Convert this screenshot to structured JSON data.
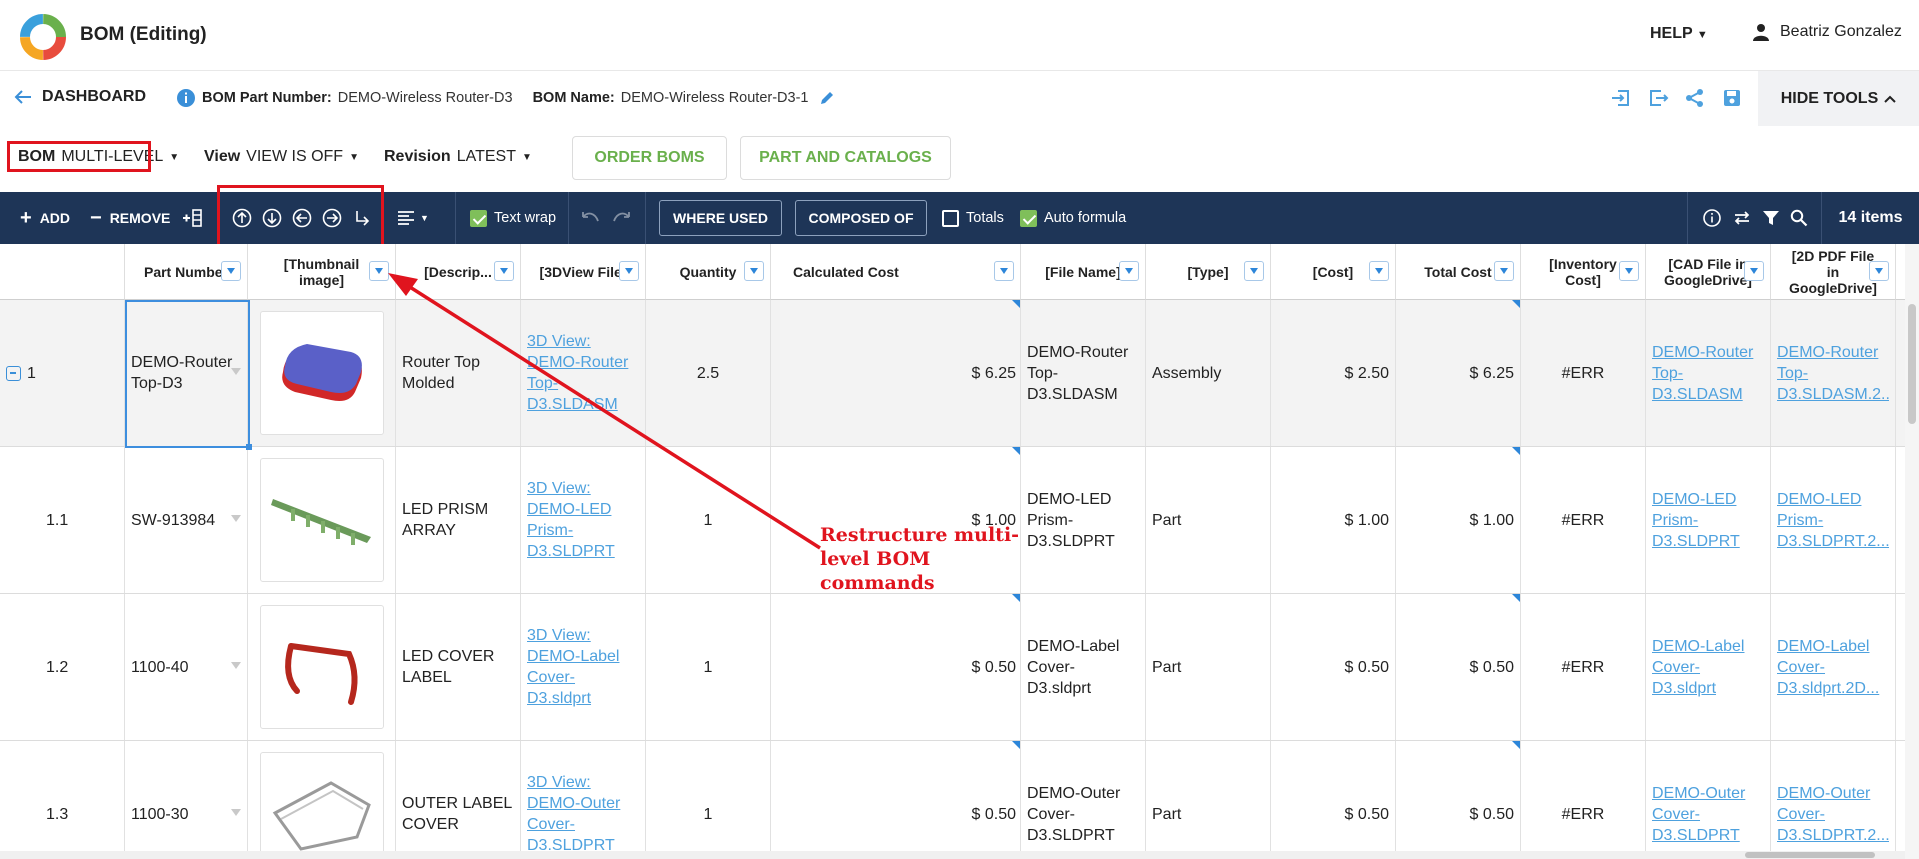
{
  "app": {
    "title": "BOM (Editing)",
    "help_label": "HELP",
    "user_name": "Beatriz Gonzalez"
  },
  "info": {
    "dashboard_label": "DASHBOARD",
    "part_number_label": "BOM Part Number:",
    "part_number_value": "DEMO-Wireless Router-D3",
    "bom_name_label": "BOM Name:",
    "bom_name_value": "DEMO-Wireless Router-D3-1",
    "hide_tools_label": "HIDE TOOLS"
  },
  "controls": {
    "bom_label": "BOM",
    "bom_value": "MULTI-LEVEL",
    "view_label": "View",
    "view_value": "VIEW IS OFF",
    "revision_label": "Revision",
    "revision_value": "LATEST",
    "order_boms": "ORDER BOMS",
    "part_catalogs": "PART AND CATALOGS"
  },
  "toolbar": {
    "add": "ADD",
    "remove": "REMOVE",
    "text_wrap": "Text wrap",
    "text_wrap_checked": true,
    "where_used": "WHERE USED",
    "composed_of": "COMPOSED OF",
    "totals": "Totals",
    "totals_checked": false,
    "auto_formula": "Auto formula",
    "auto_formula_checked": true,
    "items_count": "14 items"
  },
  "columns": [
    "Part Number",
    "[Thumbnail image]",
    "[Descrip...",
    "[3DView File]",
    "Quantity",
    "Calculated Cost",
    "[File Name]",
    "[Type]",
    "[Cost]",
    "Total Cost",
    "[Inventory Cost]",
    "[CAD File in GoogleDrive]",
    "[2D PDF File in GoogleDrive]"
  ],
  "rows": [
    {
      "level": "1",
      "part_number": "DEMO-Router Top-D3",
      "description": "Router Top Molded",
      "view3d": "3D View: DEMO-Router Top-D3.SLDASM",
      "quantity": "2.5",
      "calc_cost": "$ 6.25",
      "file_name": "DEMO-Router Top-D3.SLDASM",
      "type": "Assembly",
      "cost": "$ 2.50",
      "total_cost": "$ 6.25",
      "inventory_cost": "#ERR",
      "cad_file": "DEMO-Router Top-D3.SLDASM",
      "pdf_file": "DEMO-Router Top-D3.SLDASM.2...",
      "thumb_icon": "router-top-thumbnail"
    },
    {
      "level": "1.1",
      "part_number": "SW-913984",
      "description": "LED PRISM ARRAY",
      "view3d": "3D View: DEMO-LED Prism-D3.SLDPRT",
      "quantity": "1",
      "calc_cost": "$ 1.00",
      "file_name": "DEMO-LED Prism-D3.SLDPRT",
      "type": "Part",
      "cost": "$ 1.00",
      "total_cost": "$ 1.00",
      "inventory_cost": "#ERR",
      "cad_file": "DEMO-LED Prism-D3.SLDPRT",
      "pdf_file": "DEMO-LED Prism-D3.SLDPRT.2...",
      "thumb_icon": "led-prism-thumbnail"
    },
    {
      "level": "1.2",
      "part_number": "1100-40",
      "description": "LED COVER LABEL",
      "view3d": "3D View: DEMO-Label Cover-D3.sldprt",
      "quantity": "1",
      "calc_cost": "$ 0.50",
      "file_name": "DEMO-Label Cover-D3.sldprt",
      "type": "Part",
      "cost": "$ 0.50",
      "total_cost": "$ 0.50",
      "inventory_cost": "#ERR",
      "cad_file": "DEMO-Label Cover-D3.sldprt",
      "pdf_file": "DEMO-Label Cover-D3.sldprt.2D...",
      "thumb_icon": "label-cover-thumbnail"
    },
    {
      "level": "1.3",
      "part_number": "1100-30",
      "description": "OUTER LABEL COVER",
      "view3d": "3D View: DEMO-Outer Cover-D3.SLDPRT",
      "quantity": "1",
      "calc_cost": "$ 0.50",
      "file_name": "DEMO-Outer Cover-D3.SLDPRT",
      "type": "Part",
      "cost": "$ 0.50",
      "total_cost": "$ 0.50",
      "inventory_cost": "#ERR",
      "cad_file": "DEMO-Outer Cover-D3.SLDPRT",
      "pdf_file": "DEMO-Outer Cover-D3.SLDPRT.2...",
      "thumb_icon": "outer-cover-thumbnail"
    }
  ],
  "annotation": {
    "text": "Restructure multi-level BOM commands",
    "color": "#e0141e"
  },
  "colors": {
    "toolbar_bg": "#1e3557",
    "accent_green": "#6ab04c",
    "link_blue": "#4ea1de",
    "annotation_red": "#e0141e"
  }
}
